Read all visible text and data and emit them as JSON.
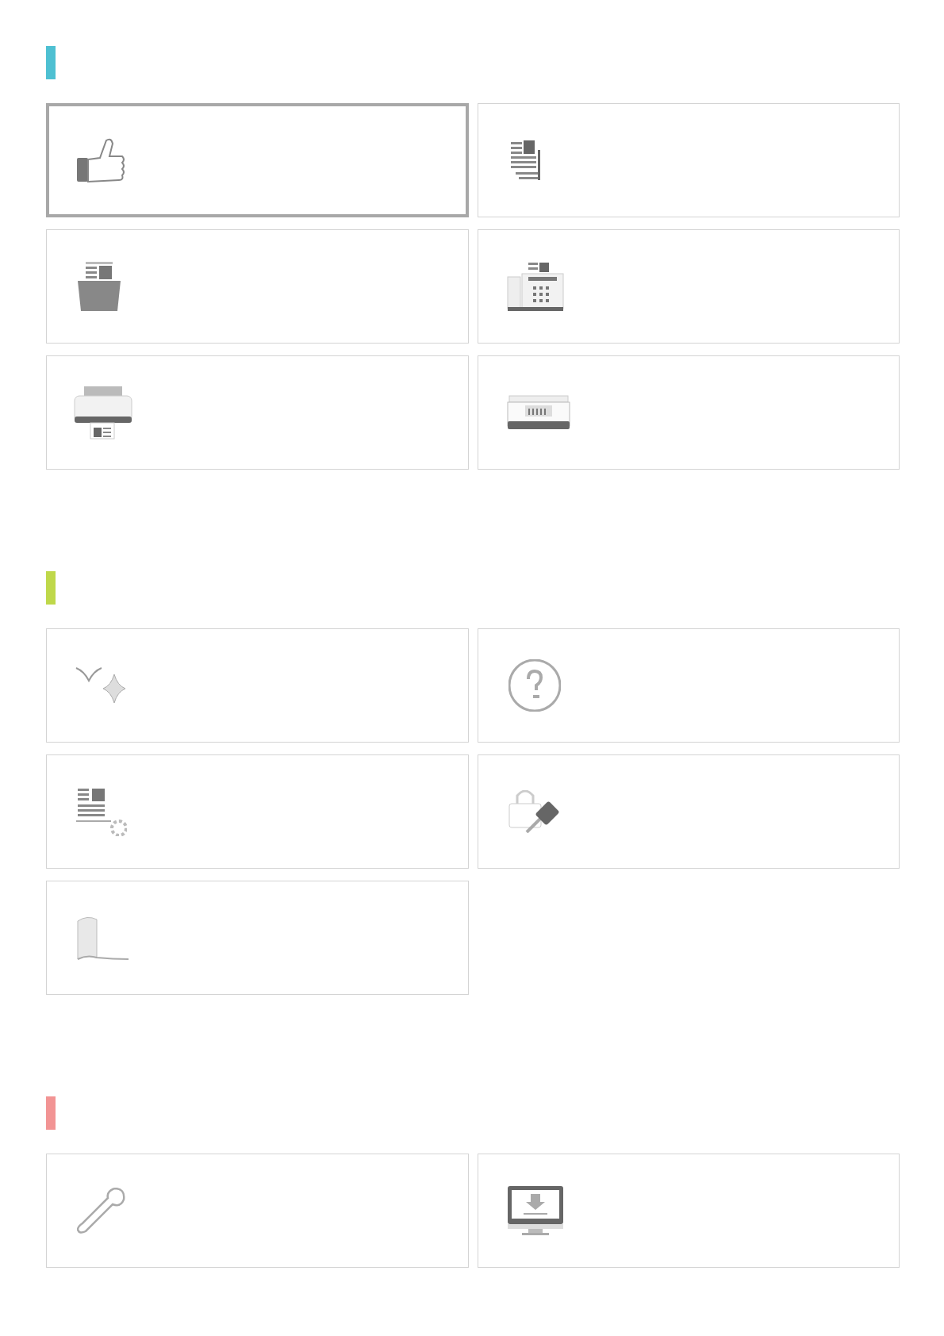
{
  "sections": [
    {
      "color": "#4ec0d2",
      "tiles": [
        {
          "kind": "thumbs",
          "selected": true
        },
        {
          "kind": "copy",
          "selected": false
        },
        {
          "kind": "box",
          "selected": false
        },
        {
          "kind": "fax",
          "selected": false
        },
        {
          "kind": "printer",
          "selected": false
        },
        {
          "kind": "scanner",
          "selected": false
        }
      ]
    },
    {
      "color": "#bfd84a",
      "tiles": [
        {
          "kind": "sparkle",
          "selected": false
        },
        {
          "kind": "help",
          "selected": false
        },
        {
          "kind": "docgear",
          "selected": false
        },
        {
          "kind": "lockkey",
          "selected": false
        },
        {
          "kind": "book",
          "selected": false
        }
      ]
    },
    {
      "color": "#f29494",
      "tiles": [
        {
          "kind": "wrench",
          "selected": false
        },
        {
          "kind": "monitor",
          "selected": false
        }
      ]
    }
  ]
}
